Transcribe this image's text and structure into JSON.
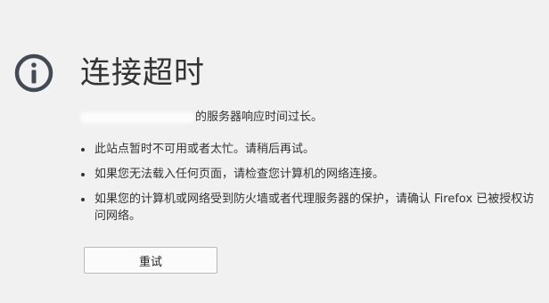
{
  "error": {
    "icon": "info-circle-icon",
    "title": "连接超时",
    "host_suffix": "的服务器响应时间过长。",
    "reasons": [
      "此站点暂时不可用或者太忙。请稍后再试。",
      "如果您无法载入任何页面，请检查您计算机的网络连接。",
      "如果您的计算机或网络受到防火墙或者代理服务器的保护，请确认 Firefox 已被授权访问网络。"
    ],
    "retry_label": "重试"
  },
  "colors": {
    "background": "#f1f1f1",
    "text": "#333333",
    "icon": "#434a54"
  }
}
